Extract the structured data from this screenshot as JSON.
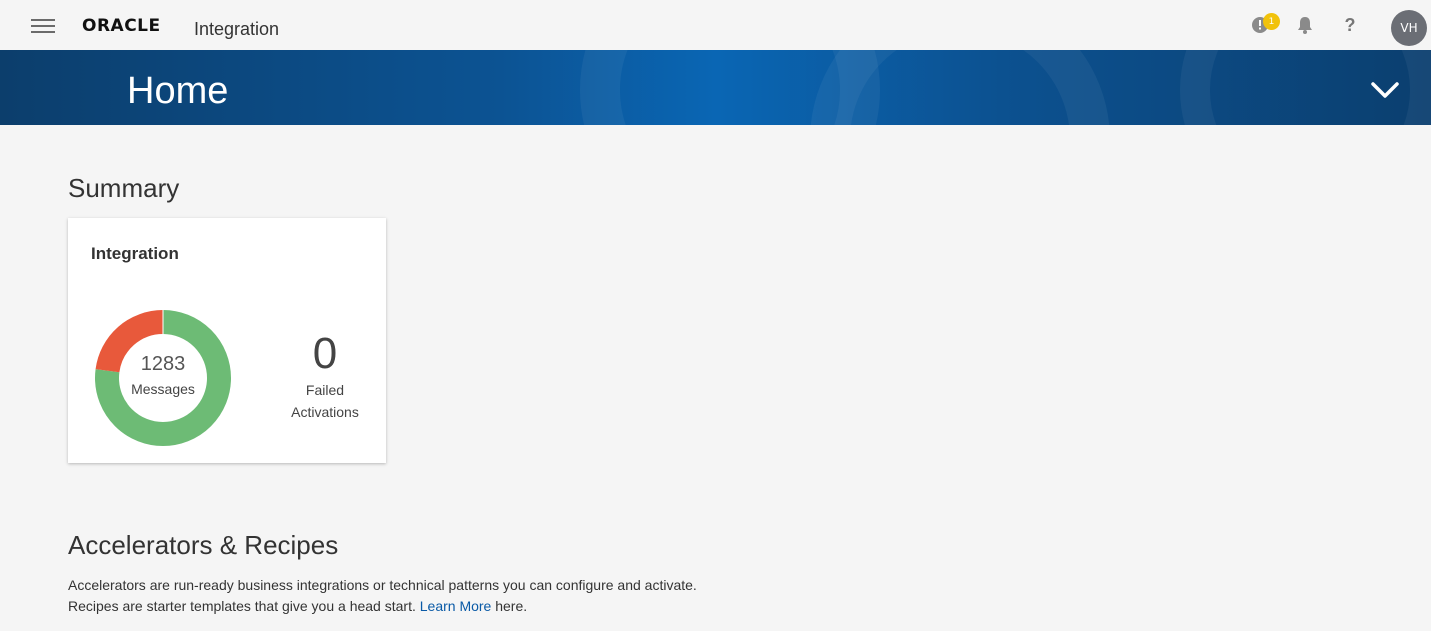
{
  "topbar": {
    "brand_logo": "ORACLE",
    "brand_app": "Integration",
    "notification_badge": "1",
    "help_glyph": "?",
    "avatar_initials": "VH",
    "icons": [
      "hamburger-menu-icon",
      "message-icon",
      "bell-icon",
      "help-icon"
    ]
  },
  "banner": {
    "title": "Home",
    "icon": "chevron-down-icon"
  },
  "summary": {
    "title": "Summary",
    "card": {
      "title": "Integration",
      "messages_count": "1283",
      "messages_label": "Messages",
      "failed_count": "0",
      "failed_label_line1": "Failed",
      "failed_label_line2": "Activations",
      "donut_segments": [
        {
          "color": "#6dbb75",
          "fraction": 0.77
        },
        {
          "color": "#e8593b",
          "fraction": 0.23
        }
      ]
    }
  },
  "accelerators": {
    "title": "Accelerators & Recipes",
    "line1": "Accelerators are run-ready business integrations or technical patterns you can configure and activate.",
    "line2_prefix": "Recipes are starter templates that give you a head start.",
    "learn_more": "Learn More",
    "line2_suffix": "here."
  },
  "colors": {
    "banner_dark": "#0c3e6c",
    "banner_light": "#0a66b4",
    "link": "#0a5aa6",
    "badge": "#f1c20b",
    "donut_success": "#6dbb75",
    "donut_error": "#e8593b"
  }
}
